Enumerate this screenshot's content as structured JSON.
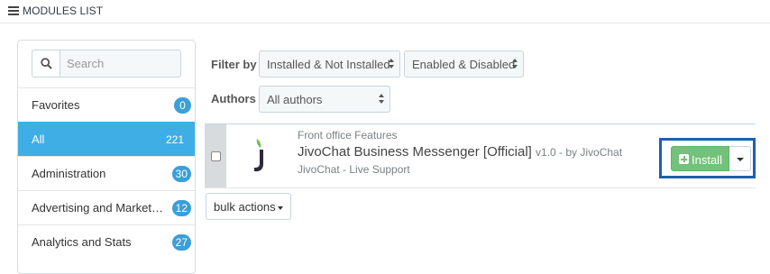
{
  "header": {
    "title": "MODULES LIST",
    "icon": "list-icon"
  },
  "sidebar": {
    "search": {
      "placeholder": "Search",
      "value": ""
    },
    "categories": [
      {
        "label": "Favorites",
        "count": "0",
        "active": false
      },
      {
        "label": "All",
        "count": "221",
        "active": true
      },
      {
        "label": "Administration",
        "count": "30",
        "active": false
      },
      {
        "label": "Advertising and Marketing",
        "count": "12",
        "active": false
      },
      {
        "label": "Analytics and Stats",
        "count": "27",
        "active": false
      }
    ]
  },
  "filters": {
    "filter_by_label": "Filter by",
    "install_status": "Installed & Not Installed",
    "enable_status": "Enabled & Disabled",
    "authors_label": "Authors",
    "authors": "All authors"
  },
  "module": {
    "category": "Front office Features",
    "name": "JivoChat Business Messenger [Official]",
    "version": "v1.0 - by JivoChat",
    "description": "JivoChat - Live Support",
    "install_label": "Install"
  },
  "bulk_actions": {
    "label": "bulk actions"
  },
  "colors": {
    "accent": "#3eaee5",
    "badge": "#3b9fd8",
    "install": "#72c279",
    "highlight_border": "#1f5fae",
    "logo_green": "#6cc24a",
    "logo_dark": "#2e2a3c"
  }
}
